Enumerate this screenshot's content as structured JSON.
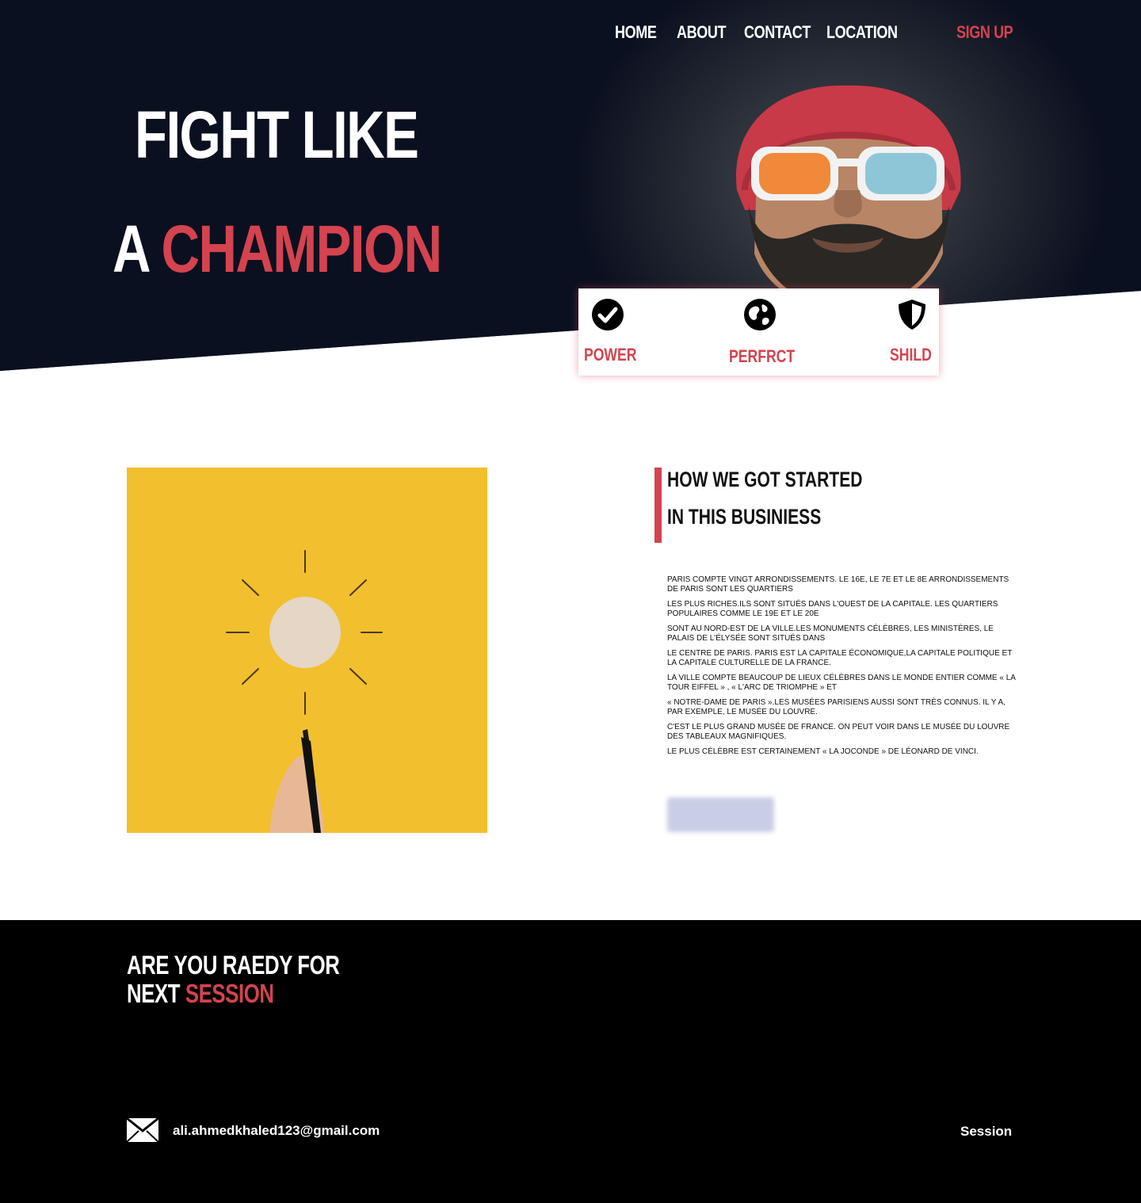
{
  "nav": {
    "home": "HOME",
    "about": "ABOUT",
    "contact": "CONTACT",
    "location": "LOCATION",
    "signup": "SIGN UP"
  },
  "hero": {
    "line1": "FIGHT LIKE",
    "line2_prefix": "A",
    "line2_accent": "CHAMPION"
  },
  "features": [
    {
      "label": "POWER",
      "icon": "check-circle-icon"
    },
    {
      "label": "PERFRCT",
      "icon": "globe-icon"
    },
    {
      "label": "SHILD",
      "icon": "shield-icon"
    }
  ],
  "about": {
    "heading_line1": "HOW WE GOT STARTED",
    "heading_line2": "IN THIS BUSINIESS",
    "paragraphs": [
      "PARIS COMPTE VINGT ARRONDISSEMENTS. LE 16E, LE 7E ET LE 8E ARRONDISSEMENTS DE PARIS SONT LES QUARTIERS",
      "LES PLUS RICHES.ILS SONT SITUÉS DANS L'OUEST DE LA CAPITALE. LES QUARTIERS POPULAIRES COMME LE 19E ET LE 20E",
      "SONT AU NORD-EST DE LA VILLE.LES MONUMENTS CÉLÈBRES, LES MINISTÈRES, LE PALAIS DE L'ÉLYSÉE SONT SITUÉS DANS",
      " LE CENTRE DE PARIS. PARIS EST LA CAPITALE ÉCONOMIQUE,LA CAPITALE POLITIQUE ET LA CAPITALE CULTURELLE DE LA FRANCE.",
      " LA VILLE COMPTE BEAUCOUP DE LIEUX CÉLÈBRES DANS LE MONDE ENTIER COMME « LA TOUR EIFFEL » , « L'ARC DE TRIOMPHE » ET",
      " « NOTRE-DAME DE PARIS ».LES MUSÉES PARISIENS AUSSI SONT TRÈS CONNUS. IL Y A, PAR EXEMPLE, LE MUSÉE DU LOUVRE.",
      " C'EST LE PLUS GRAND MUSÉE DE FRANCE. ON PEUT VOIR DANS LE MUSÉE DU LOUVRE DES TABLEAUX MAGNIFIQUES.",
      "LE PLUS CÉLÈBRE EST CERTAINEMENT « LA JOCONDE » DE LÉONARD DE VINCI."
    ]
  },
  "footer": {
    "heading_line1": "ARE YOU RAEDY FOR",
    "heading_line2_prefix": "NEXT",
    "heading_line2_accent": "SESSION",
    "email": "ali.ahmedkhaled123@gmail.com",
    "session_link": "Session"
  },
  "colors": {
    "accent": "#d4434f",
    "hero_bg": "#0b1020",
    "footer_bg": "#000000",
    "image_bg": "#f2bf2e"
  }
}
